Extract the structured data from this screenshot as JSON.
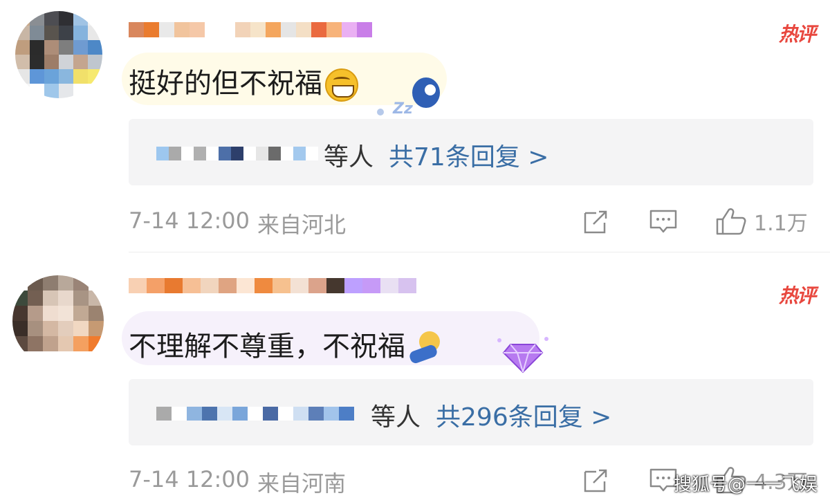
{
  "comments": [
    {
      "badge": "热评",
      "text": "挺好的但不祝福",
      "reply_suffix": "等人",
      "reply_count": "共71条回复 >",
      "time": "7-14 12:00",
      "location": "来自河北",
      "likes": "1.1万",
      "avatar_colors": [
        "#c9a98a",
        "#8a8e93",
        "#4d4d52",
        "#2f2f33",
        "#a0c3e4",
        "#f0f0f0",
        "#c8b6a5",
        "#7f8b96",
        "#59544e",
        "#3d4148",
        "#85b3dd",
        "#e8e8e8",
        "#bf9d7e",
        "#2b2b2b",
        "#ad8d78",
        "#7e7e7e",
        "#6f9bd1",
        "#4d88c7",
        "#d1bdaa",
        "#2c2c2c",
        "#9d7d68",
        "#d0d3d8",
        "#c4a58f",
        "#bfc6ce",
        "#e6e6e6",
        "#5e96d8",
        "#6aa3da",
        "#8ab7de",
        "#f1e06a",
        "#f6e96f",
        "#f5f5f5",
        "#ffffff",
        "#9fc7ea",
        "#e5e7ea",
        "#ffffff",
        "#ffffff"
      ],
      "username_colors": [
        "#d9875d",
        "#ea7c2f",
        "#e9e9e9",
        "#f1c49d",
        "#f5c8a8",
        "#ffffff",
        "#ffffff",
        "#f2d3b8",
        "#f6e4c9",
        "#f4a65e",
        "#e5e5e5",
        "#f4dfc5",
        "#ea6a3f",
        "#f7b37a",
        "#eab0f3",
        "#c97ee8"
      ],
      "reply_name_colors": [
        "#9dc7ef",
        "#aaaaaa",
        "#ffffff",
        "#b0b0b0",
        "#ffffff",
        "#4d6fa8",
        "#2d3f6b",
        "#ffffff",
        "#e6e6e6",
        "#6b6b6b",
        "#ffffff",
        "#a3c9ee",
        "#ffffff"
      ]
    },
    {
      "badge": "热评",
      "text": "不理解不尊重，不祝福",
      "reply_suffix": "等人",
      "reply_count": "共296条回复 >",
      "time": "7-14 12:00",
      "location": "来自河南",
      "likes": "4.3万",
      "avatar_colors": [
        "#ffffff",
        "#6b5a4e",
        "#8e7d70",
        "#b8a89a",
        "#9a8477",
        "#ffffff",
        "#3d4a3c",
        "#735f52",
        "#d7c5b6",
        "#e8d8cc",
        "#a89484",
        "#c9b7a8",
        "#47372f",
        "#b59b8a",
        "#efddd0",
        "#f2e3d7",
        "#c1a994",
        "#9b8370",
        "#3a2e28",
        "#a7907f",
        "#d4b8a3",
        "#e3cdbc",
        "#f1d8c2",
        "#c69a73",
        "#5c4a40",
        "#8e7464",
        "#c0a28d",
        "#e4c8b1",
        "#f4a060",
        "#f07b2d",
        "#ffffff",
        "#ffffff",
        "#ffffff",
        "#ffffff",
        "#ffffff",
        "#ffffff"
      ],
      "username_colors": [
        "#f8d0b3",
        "#f4a068",
        "#e87a30",
        "#f6bf95",
        "#f1d5be",
        "#dfa482",
        "#fce6d4",
        "#ef8a3f",
        "#f6c18f",
        "#f3e1d4",
        "#dba38b",
        "#45372e",
        "#bda0ff",
        "#c69af7",
        "#e9e0f3",
        "#d7c2ef"
      ],
      "reply_name_colors": [
        "#aaaaaa",
        "#ffffff",
        "#8fb5e0",
        "#4d74ae",
        "#d8e6f5",
        "#7aa6da",
        "#ffffff",
        "#4a6aa5",
        "#ffffff",
        "#cfdff2",
        "#5d7fb8",
        "#a2c4eb",
        "#4d7ec6"
      ]
    }
  ],
  "icons": {
    "share": "share-icon",
    "comment": "comment-icon",
    "like": "thumbs-up-icon"
  },
  "watermark": "搜狐号@一一飞娱",
  "colors": {
    "badge": "#e8473e",
    "reply_link": "#3a6ea5",
    "meta_text": "#9a9a9a",
    "reply_bg": "#f4f4f5"
  }
}
